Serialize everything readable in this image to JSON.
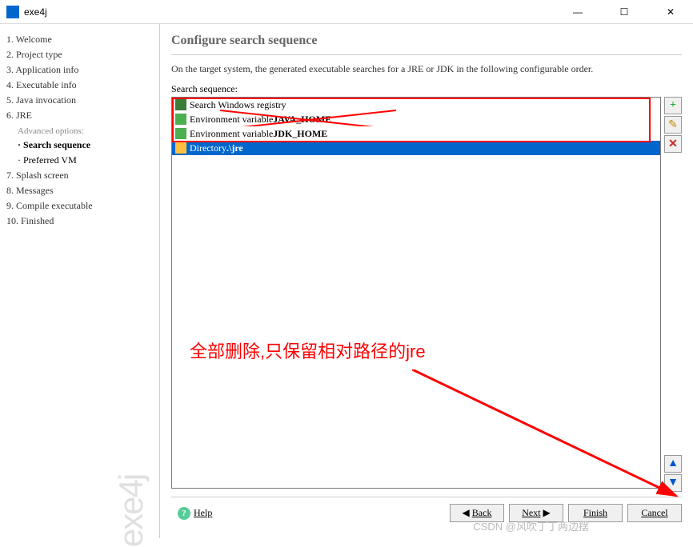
{
  "window": {
    "title": "exe4j"
  },
  "sidebar": {
    "items": [
      "1. Welcome",
      "2. Project type",
      "3. Application info",
      "4. Executable info",
      "5. Java invocation",
      "6. JRE",
      "7. Splash screen",
      "8. Messages",
      "9. Compile executable",
      "10. Finished"
    ],
    "advanced_label": "Advanced options:",
    "subs": [
      "Search sequence",
      "Preferred VM"
    ],
    "watermark": "exe4j"
  },
  "content": {
    "title": "Configure search sequence",
    "desc": "On the target system, the generated executable searches for a JRE or JDK in the following configurable order.",
    "seq_label": "Search sequence:",
    "items": [
      {
        "icon": "reg",
        "text": "Search Windows registry"
      },
      {
        "icon": "green",
        "text_pre": "Environment variable ",
        "text_bold": "JAVA_HOME"
      },
      {
        "icon": "green",
        "text_pre": "Environment variable ",
        "text_bold": "JDK_HOME"
      },
      {
        "icon": "folder",
        "text_pre": "Directory ",
        "text_bold": ".\\jre",
        "selected": true
      }
    ]
  },
  "annotation": {
    "text": "全部删除,只保留相对路径的jre"
  },
  "sidebtns": {
    "add": "+",
    "edit": "✎",
    "del": "✕",
    "up": "▲",
    "down": "▼"
  },
  "bottom": {
    "help": "Help",
    "back": "Back",
    "next": "Next",
    "finish": "Finish",
    "cancel": "Cancel"
  },
  "watermark": "CSDN @风吹丁丁两边摆"
}
